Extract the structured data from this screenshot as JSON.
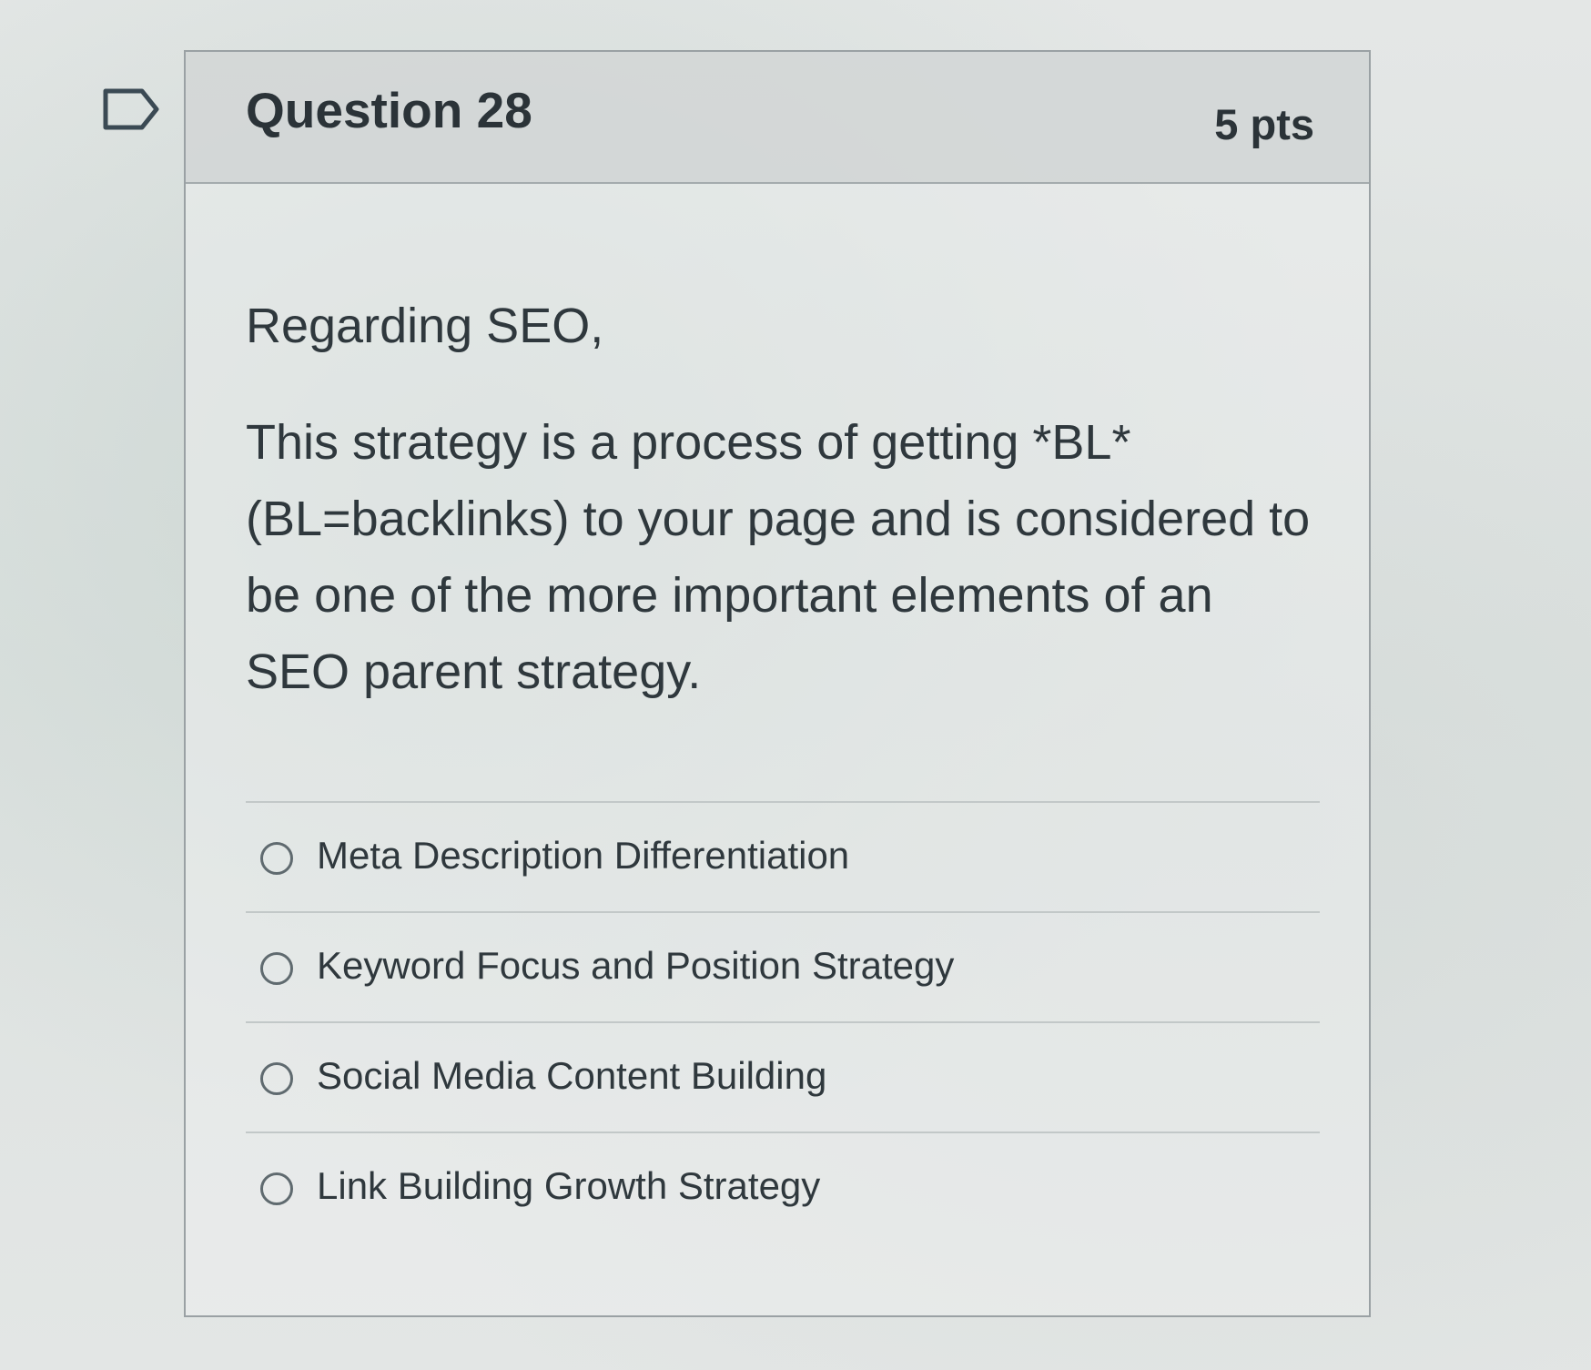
{
  "question": {
    "title": "Question 28",
    "points": "5 pts",
    "intro": "Regarding SEO,",
    "text": "This strategy is a process of getting *BL* (BL=backlinks) to your page and is considered to be one of the more important elements of an SEO parent strategy.",
    "flag_icon": "flag-outline-icon",
    "answers": [
      {
        "label": "Meta Description Differentiation",
        "selected": false
      },
      {
        "label": "Keyword Focus and Position Strategy",
        "selected": false
      },
      {
        "label": "Social Media Content Building",
        "selected": false
      },
      {
        "label": "Link Building Growth Strategy",
        "selected": false
      }
    ]
  }
}
